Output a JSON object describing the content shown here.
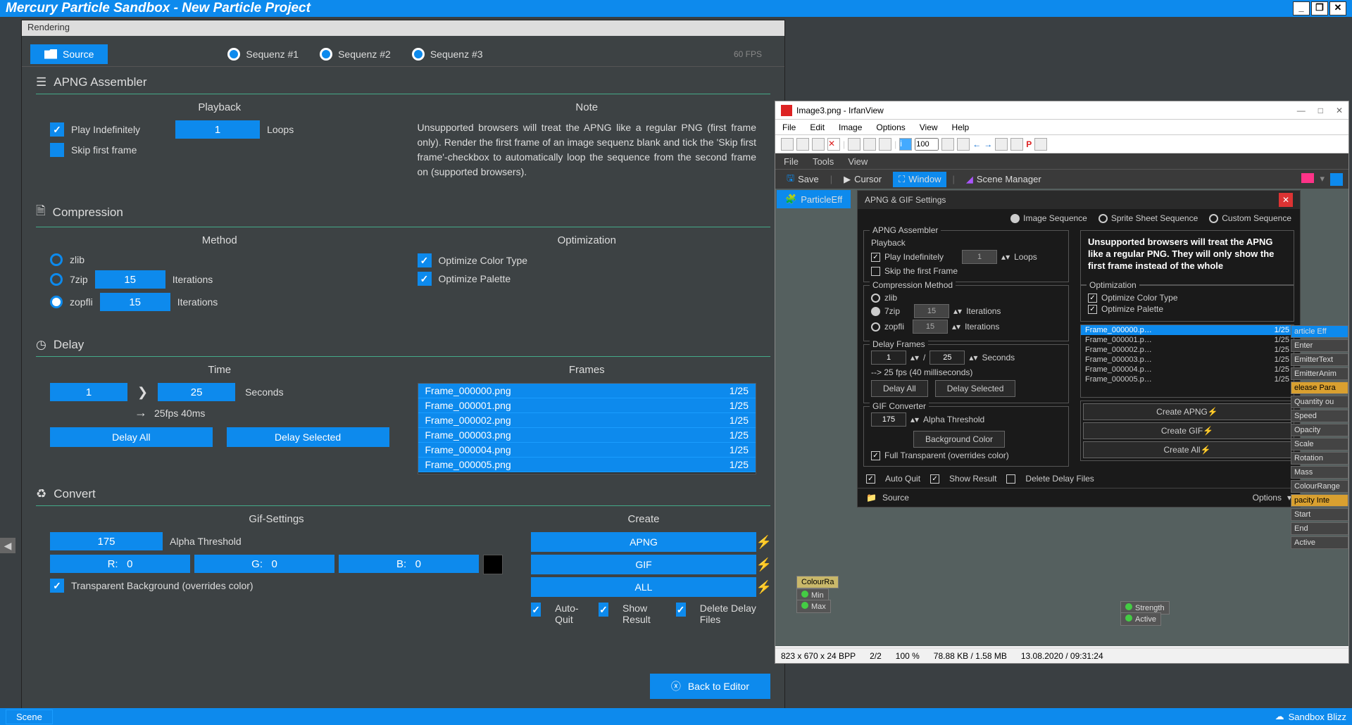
{
  "window": {
    "title": "Mercury Particle Sandbox - New Particle Project"
  },
  "statusbar": {
    "scene": "Scene",
    "user": "Sandbox Blizz"
  },
  "rendering": {
    "title": "Rendering",
    "source": "Source",
    "sequences": [
      "Sequenz #1",
      "Sequenz #2",
      "Sequenz #3"
    ],
    "fps": "60 FPS",
    "apng": {
      "header": "APNG Assembler",
      "playback_title": "Playback",
      "play_indef": "Play Indefinitely",
      "skip_first": "Skip first frame",
      "loops_val": "1",
      "loops_lbl": "Loops",
      "note_title": "Note",
      "note_text": "Unsupported browsers will treat the APNG like a regular PNG (first frame only). Render the first frame of an image sequenz blank and tick the 'Skip first frame'-checkbox to automatically loop the sequence from the second frame on (supported browsers)."
    },
    "compression": {
      "header": "Compression",
      "method": "Method",
      "zlib": "zlib",
      "zip7": "7zip",
      "zopfli": "zopfli",
      "it7": "15",
      "itz": "15",
      "iter": "Iterations",
      "opt_title": "Optimization",
      "opt_color": "Optimize Color Type",
      "opt_pal": "Optimize Palette"
    },
    "delay": {
      "header": "Delay",
      "time": "Time",
      "t1": "1",
      "t2": "25",
      "sec": "Seconds",
      "rate": "25fps 40ms",
      "delay_all": "Delay All",
      "delay_sel": "Delay Selected",
      "frames_title": "Frames",
      "frames": [
        {
          "n": "Frame_000000.png",
          "d": "1/25"
        },
        {
          "n": "Frame_000001.png",
          "d": "1/25"
        },
        {
          "n": "Frame_000002.png",
          "d": "1/25"
        },
        {
          "n": "Frame_000003.png",
          "d": "1/25"
        },
        {
          "n": "Frame_000004.png",
          "d": "1/25"
        },
        {
          "n": "Frame_000005.png",
          "d": "1/25"
        }
      ]
    },
    "convert": {
      "header": "Convert",
      "gif_title": "Gif-Settings",
      "alpha": "175",
      "alpha_lbl": "Alpha Threshold",
      "r": "R:   0",
      "g": "G:   0",
      "b": "B:   0",
      "transp": "Transparent Background (overrides color)",
      "create_title": "Create",
      "apng_btn": "APNG",
      "gif_btn": "GIF",
      "all_btn": "ALL",
      "auto_quit": "Auto-Quit",
      "show_res": "Show Result",
      "del_files": "Delete Delay Files",
      "back": "Back to Editor"
    }
  },
  "irfan": {
    "title": "Image3.png - IrfanView",
    "menus": [
      "File",
      "Edit",
      "Image",
      "Options",
      "View",
      "Help"
    ],
    "zoom": "100",
    "status": [
      "823 x 670 x 24 BPP",
      "2/2",
      "100 %",
      "78.88 KB / 1.58 MB",
      "13.08.2020 / 09:31:24"
    ]
  },
  "inner": {
    "menubar": [
      "File",
      "Tools",
      "View"
    ],
    "toolbar": {
      "save": "Save",
      "cursor": "Cursor",
      "window": "Window",
      "scene": "Scene Manager"
    },
    "pe_tab": "ParticleEff",
    "dlg": {
      "title": "APNG & GIF Settings",
      "type_img": "Image Sequence",
      "type_sprite": "Sprite Sheet Sequence",
      "type_custom": "Custom Sequence",
      "apng_leg": "APNG Assembler",
      "playback": "Playback",
      "play_indef": "Play Indefinitely",
      "loops_v": "1",
      "loops": "Loops",
      "skip": "Skip the first Frame",
      "note": "Unsupported browsers will treat the APNG like a regular PNG. They will only show the first frame instead of the whole",
      "comp_leg": "Compression Method",
      "zlib": "zlib",
      "zip7": "7zip",
      "zopfli": "zopfli",
      "it7": "15",
      "itz": "15",
      "iter": "Iterations",
      "opt_leg": "Optimization",
      "opt_c": "Optimize Color Type",
      "opt_p": "Optimize Palette",
      "delay_leg": "Delay Frames",
      "d1": "1",
      "d2": "25",
      "sec": "Seconds",
      "rate": "--> 25 fps (40 milliseconds)",
      "delay_all": "Delay All",
      "delay_sel": "Delay Selected",
      "frames": [
        {
          "n": "Frame_000000.p…",
          "d": "1/25"
        },
        {
          "n": "Frame_000001.p…",
          "d": "1/25"
        },
        {
          "n": "Frame_000002.p…",
          "d": "1/25"
        },
        {
          "n": "Frame_000003.p…",
          "d": "1/25"
        },
        {
          "n": "Frame_000004.p…",
          "d": "1/25"
        },
        {
          "n": "Frame_000005.p…",
          "d": "1/25"
        }
      ],
      "gif_leg": "GIF Converter",
      "alpha": "175",
      "alpha_lbl": "Alpha Threshold",
      "bgcolor": "Background Color",
      "full_tr": "Full Transparent (overrides color)",
      "create_apng": "Create APNG",
      "create_gif": "Create GIF",
      "create_all": "Create All",
      "auto_quit": "Auto Quit",
      "show_res": "Show Result",
      "del": "Delete Delay Files",
      "source": "Source",
      "options": "Options"
    },
    "side": {
      "pe": "article Eff",
      "enter": "Enter",
      "emtex": "EmitterText",
      "emanim": "EmitterAnim",
      "rel": "elease Para",
      "qty": "Quantity ou",
      "speed": "Speed",
      "opac": "Opacity",
      "scale": "Scale",
      "rot": "Rotation",
      "mass": "Mass",
      "crange": "ColourRange",
      "opint": "pacity Inte",
      "start": "Start",
      "end": "End",
      "active": "Active"
    },
    "node_colour": "ColourRa",
    "node_min": "Min",
    "node_max": "Max",
    "node_str": "Strength",
    "node_act": "Active"
  }
}
